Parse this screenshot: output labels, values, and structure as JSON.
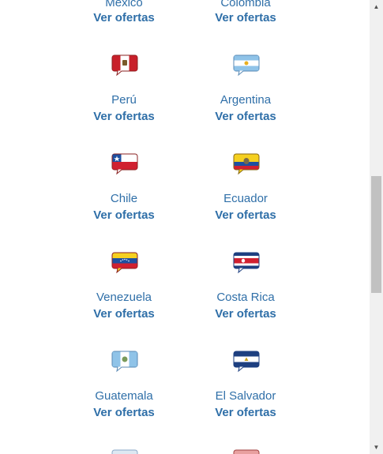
{
  "offer_label": "Ver ofertas",
  "countries": [
    {
      "name": "México",
      "flag": "mexico-flag-icon"
    },
    {
      "name": "Colombia",
      "flag": "colombia-flag-icon"
    },
    {
      "name": "Perú",
      "flag": "peru-flag-icon"
    },
    {
      "name": "Argentina",
      "flag": "argentina-flag-icon"
    },
    {
      "name": "Chile",
      "flag": "chile-flag-icon"
    },
    {
      "name": "Ecuador",
      "flag": "ecuador-flag-icon"
    },
    {
      "name": "Venezuela",
      "flag": "venezuela-flag-icon"
    },
    {
      "name": "Costa Rica",
      "flag": "costa-rica-flag-icon"
    },
    {
      "name": "Guatemala",
      "flag": "guatemala-flag-icon"
    },
    {
      "name": "El Salvador",
      "flag": "el-salvador-flag-icon"
    }
  ],
  "colors": {
    "link": "#2f6fa8"
  },
  "scrollbar": {
    "up_icon": "arrow-up-icon",
    "down_icon": "arrow-down-icon"
  }
}
